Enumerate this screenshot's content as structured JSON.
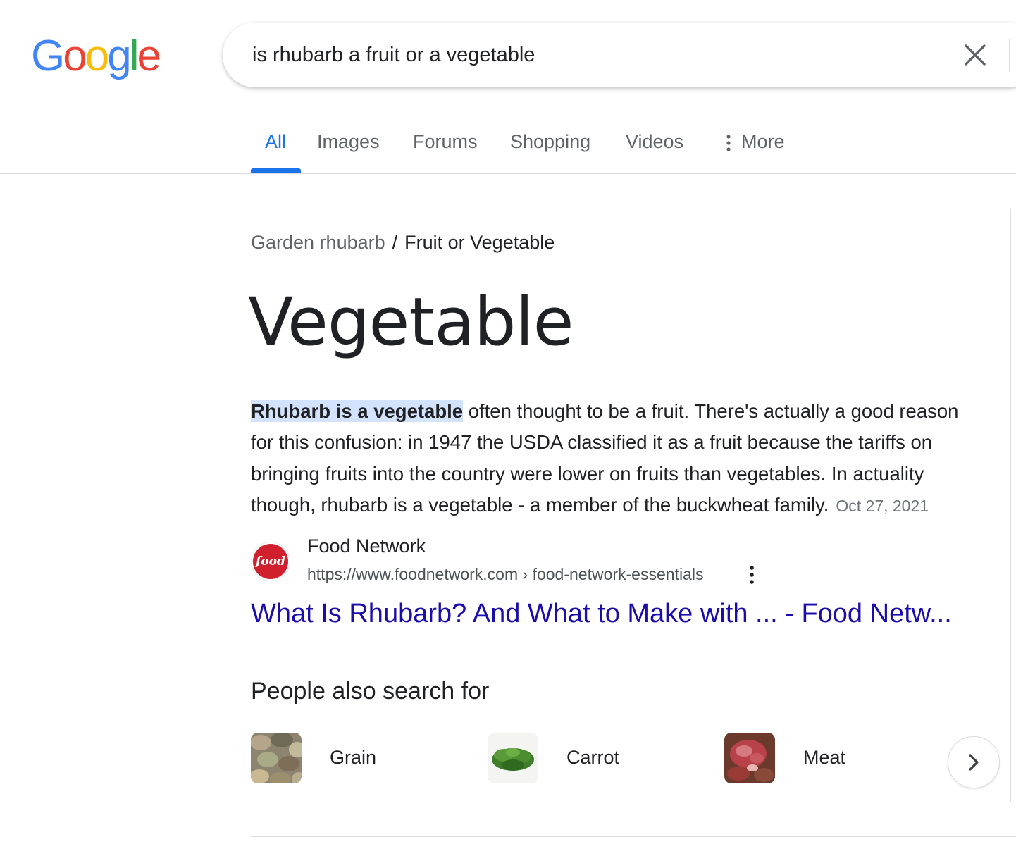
{
  "logo": {
    "letters": [
      "G",
      "o",
      "o",
      "g",
      "l",
      "e"
    ],
    "colors": [
      "#4285f4",
      "#ea4335",
      "#fbbc05",
      "#4285f4",
      "#34a853",
      "#ea4335"
    ]
  },
  "search": {
    "query": "is rhubarb a fruit or a vegetable",
    "clear_icon": "close-icon"
  },
  "tabs": [
    {
      "label": "All",
      "active": true
    },
    {
      "label": "Images",
      "active": false
    },
    {
      "label": "Forums",
      "active": false
    },
    {
      "label": "Shopping",
      "active": false
    },
    {
      "label": "Videos",
      "active": false
    },
    {
      "label": "More",
      "active": false,
      "icon": "vertical-dots-icon"
    }
  ],
  "breadcrumb": {
    "parent": "Garden rhubarb",
    "separator": "/",
    "current": "Fruit or Vegetable"
  },
  "answer": "Vegetable",
  "snippet": {
    "highlight": "Rhubarb is a vegetable",
    "text": " often thought to be a fruit. There's actually a good reason for this confusion: in 1947 the USDA classified it as a fruit because the tariffs on bringing fruits into the country were lower on fruits than vegetables. In actuality though, rhubarb is a vegetable - a member of the buckwheat family.",
    "date": "Oct 27, 2021"
  },
  "source": {
    "name": "Food Network",
    "url": "https://www.foodnetwork.com › food-network-essentials",
    "favicon_text": "food",
    "favicon_color": "#d0202e",
    "title": "What Is Rhubarb? And What to Make with ... - Food Netw..."
  },
  "people_also_search": {
    "heading": "People also search for",
    "items": [
      {
        "label": "Grain"
      },
      {
        "label": "Carrot"
      },
      {
        "label": "Meat"
      }
    ],
    "next_icon": "chevron-right-icon"
  },
  "colors": {
    "accent": "#1a73e8",
    "link": "#1a0dab",
    "highlight": "#d3e3fd"
  }
}
